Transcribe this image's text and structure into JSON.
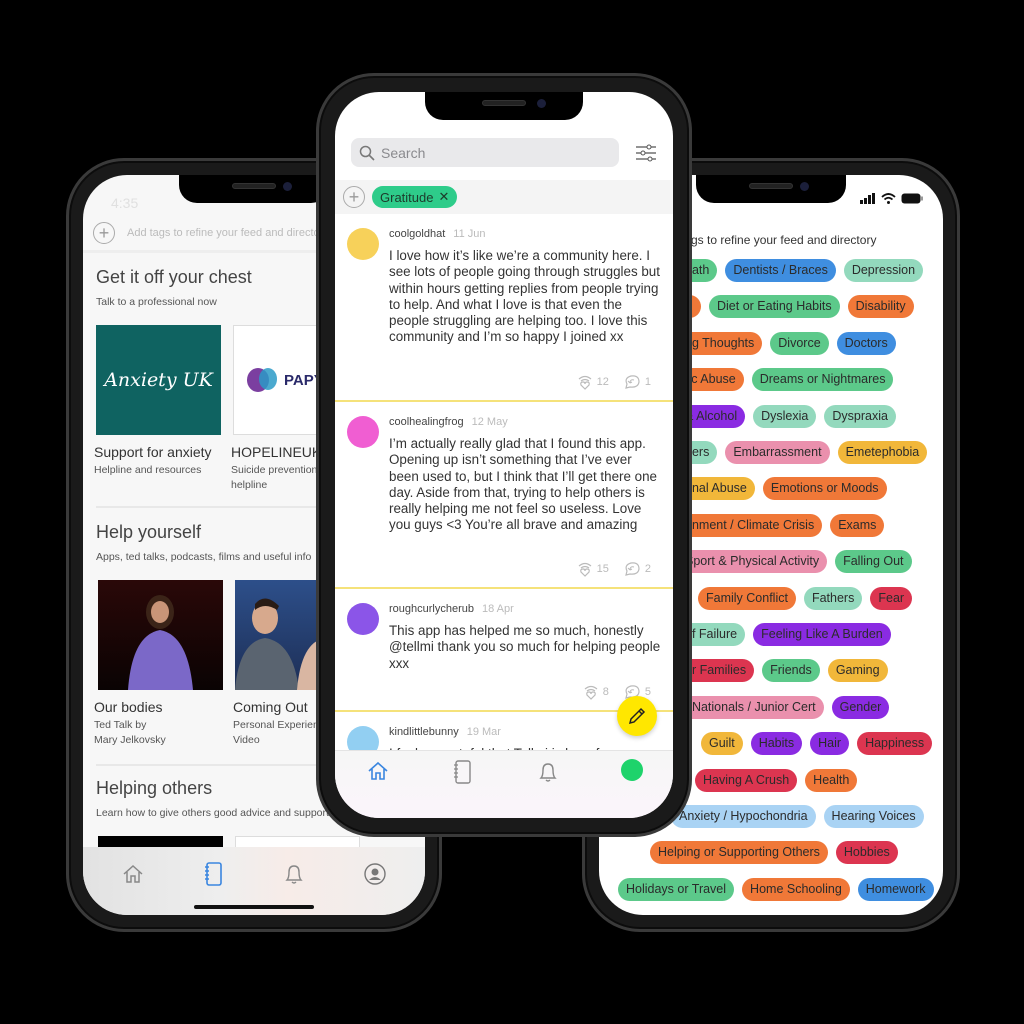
{
  "left_phone": {
    "status_time": "4:35",
    "tag_prompt": "Add tags to refine your feed and directory",
    "sections": [
      {
        "title": "Get it off your chest",
        "subtitle": "Talk to a professional now",
        "cards": [
          {
            "logo_text": "Anxiety UK",
            "title": "Support for anxiety",
            "sub1": "Helpline and resources",
            "sub2": ""
          },
          {
            "logo_text": "PAPY",
            "title": "HOPELINEUK",
            "sub1": "Suicide prevention",
            "sub2": "helpline"
          }
        ]
      },
      {
        "title": "Help yourself",
        "subtitle": "Apps, ted talks, podcasts, films and useful info",
        "cards": [
          {
            "title": "Our bodies",
            "sub1": "Ted Talk by",
            "sub2": "Mary Jelkovsky"
          },
          {
            "title": "Coming Out",
            "sub1": "Personal Experience",
            "sub2": "Video"
          }
        ]
      },
      {
        "title": "Helping others",
        "subtitle": "Learn how to give others good advice and support"
      }
    ],
    "nav": [
      "home-icon",
      "journal-icon",
      "bell-icon",
      "profile-icon"
    ],
    "active_nav": "journal-icon"
  },
  "center_phone": {
    "search_placeholder": "Search",
    "active_tag": "Gratitude",
    "posts": [
      {
        "user": "coolgoldhat",
        "date": "11 Jun",
        "avatar": "#f7d15a",
        "text": "I love how it’s like we’re a community here. I see lots of people going through struggles but within hours getting replies from people trying to help. And what I love is that even the people struggling are helping too. I love this community and I’m so happy I joined xx",
        "hugs": "12",
        "replies": "1"
      },
      {
        "user": "coolhealingfrog",
        "date": "12 May",
        "avatar": "#f05ed2",
        "text": "I’m actually really glad that I found this app. Opening up isn’t something that I’ve ever been used to, but I think that I’ll get there one day. Aside from that, trying to help others is really helping me not feel so useless. Love you guys <3 You’re all brave and amazing",
        "hugs": "15",
        "replies": "2"
      },
      {
        "user": "roughcurlycherub",
        "date": "18 Apr",
        "avatar": "#8b55e8",
        "text": "This app has helped me so much, honestly @tellmi thank you so much for helping people xxx",
        "hugs": "8",
        "replies": "5"
      },
      {
        "user": "kindlittlebunny",
        "date": "19 Mar",
        "avatar": "#92cff2",
        "text": "I feel so grateful that Tellmi is here for me",
        "hugs": "",
        "replies": ""
      }
    ],
    "nav": [
      "home-icon",
      "journal-icon",
      "bell-icon",
      "profile-avatar"
    ],
    "active_nav": "home-icon",
    "accent": "#2ecc8a",
    "fab_color": "#ffe700"
  },
  "right_phone": {
    "tag_prompt": "gs to refine your feed and directory",
    "palette": {
      "green": "#5cc98a",
      "blue": "#3f8ee0",
      "mint": "#93d9bd",
      "orange": "#f07838",
      "purple": "#8a2be2",
      "pink": "#ea90ad",
      "yellow": "#f1b73a",
      "red": "#dc3550",
      "lightblue": "#a9d3f4"
    },
    "tag_rows": [
      [
        {
          "label": "eath",
          "c": "green"
        },
        {
          "label": "Dentists / Braces",
          "c": "blue"
        },
        {
          "label": "Depression",
          "c": "mint"
        }
      ],
      [
        {
          "label": "",
          "c": "orange"
        },
        {
          "label": "Diet or Eating Habits",
          "c": "green"
        },
        {
          "label": "Disability",
          "c": "orange"
        }
      ],
      [
        {
          "label": "ng Thoughts",
          "c": "orange"
        },
        {
          "label": "Divorce",
          "c": "green"
        },
        {
          "label": "Doctors",
          "c": "blue"
        }
      ],
      [
        {
          "label": "tic Abuse",
          "c": "orange"
        },
        {
          "label": "Dreams or Nightmares",
          "c": "green"
        }
      ],
      [
        {
          "label": "& Alcohol",
          "c": "purple"
        },
        {
          "label": "Dyslexia",
          "c": "mint"
        },
        {
          "label": "Dyspraxia",
          "c": "mint"
        }
      ],
      [
        {
          "label": "ders",
          "c": "mint"
        },
        {
          "label": "Embarrassment",
          "c": "pink"
        },
        {
          "label": "Emetephobia",
          "c": "yellow"
        }
      ],
      [
        {
          "label": "onal Abuse",
          "c": "yellow"
        },
        {
          "label": "Emotions or Moods",
          "c": "orange"
        }
      ],
      [
        {
          "label": "onment / Climate Crisis",
          "c": "orange"
        },
        {
          "label": "Exams",
          "c": "orange"
        }
      ],
      [
        {
          "label": "Sport & Physical Activity",
          "c": "pink"
        },
        {
          "label": "Falling Out",
          "c": "green"
        }
      ],
      [
        {
          "label": "Family Conflict",
          "c": "orange"
        },
        {
          "label": "Fathers",
          "c": "mint"
        },
        {
          "label": "Fear",
          "c": "red"
        }
      ],
      [
        {
          "label": "of Failure",
          "c": "mint"
        },
        {
          "label": "Feeling Like A Burden",
          "c": "purple"
        }
      ],
      [
        {
          "label": "er Families",
          "c": "red"
        },
        {
          "label": "Friends",
          "c": "green"
        },
        {
          "label": "Gaming",
          "c": "yellow"
        }
      ],
      [
        {
          "label": "/ Nationals / Junior Cert",
          "c": "pink"
        },
        {
          "label": "Gender",
          "c": "purple"
        }
      ],
      [
        {
          "label": "Guilt",
          "c": "yellow"
        },
        {
          "label": "Habits",
          "c": "purple"
        },
        {
          "label": "Hair",
          "c": "purple"
        },
        {
          "label": "Happiness",
          "c": "red"
        }
      ],
      [
        {
          "label": "Having A Crush",
          "c": "red"
        },
        {
          "label": "Health",
          "c": "orange"
        }
      ],
      [
        {
          "label": "Anxiety / Hypochondria",
          "c": "lightblue"
        },
        {
          "label": "Hearing Voices",
          "c": "lightblue"
        }
      ],
      [
        {
          "label": "Helping or Supporting Others",
          "c": "orange"
        },
        {
          "label": "Hobbies",
          "c": "red"
        }
      ],
      [
        {
          "label": "Holidays or Travel",
          "c": "green"
        },
        {
          "label": "Home Schooling",
          "c": "orange"
        },
        {
          "label": "Homework",
          "c": "blue"
        }
      ]
    ]
  }
}
